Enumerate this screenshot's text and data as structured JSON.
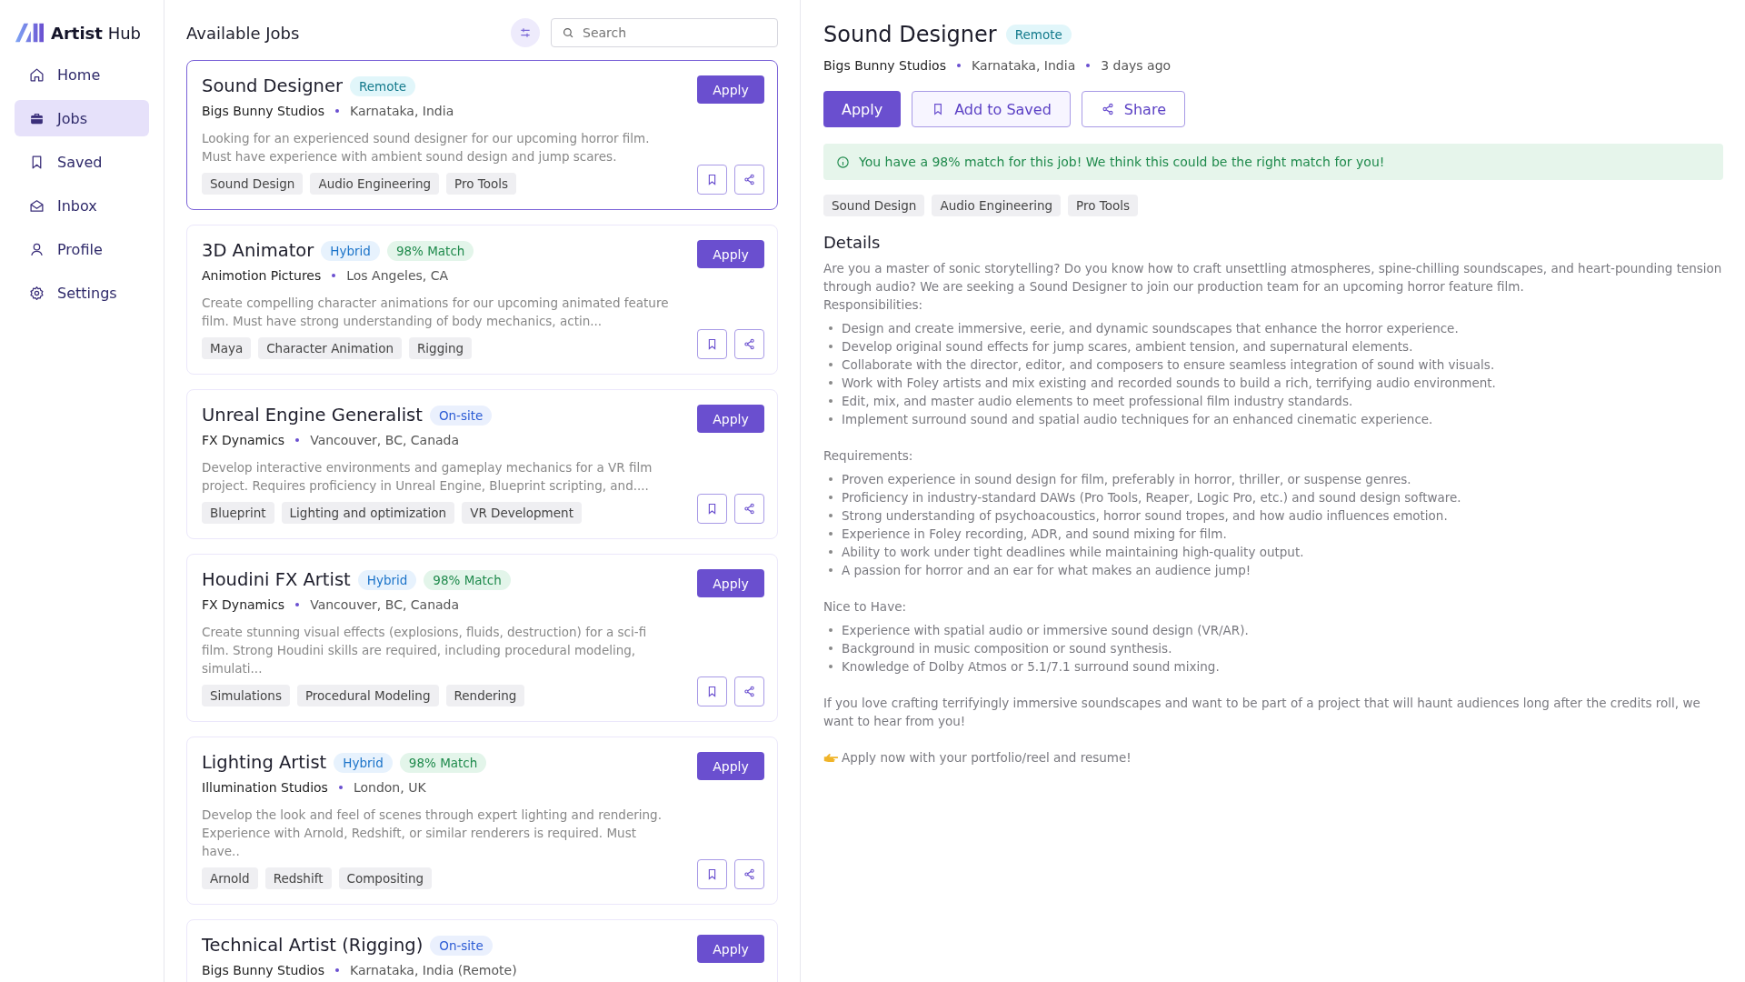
{
  "sidebar": {
    "brand": "**Artist** Hub",
    "items": [
      {
        "label": "Home",
        "selected": false
      },
      {
        "label": "Jobs",
        "selected": true
      },
      {
        "label": "Saved",
        "selected": false
      },
      {
        "label": "Inbox",
        "selected": false
      },
      {
        "label": "Profile",
        "selected": false
      },
      {
        "label": "Settings",
        "selected": false
      }
    ]
  },
  "job_list": {
    "title": "Available Jobs",
    "search": {
      "placeholder": "Search"
    },
    "jobs": [
      {
        "title": "Sound Designer",
        "selected": true,
        "badges": [
          {
            "kind": "remote",
            "text": "Remote"
          }
        ],
        "company": "Bigs Bunny Studios",
        "location": "Karnataka, India",
        "description": "Looking for an experienced sound designer for our upcoming horror film. Must have experience with ambient sound design and jump scares.",
        "skills": [
          "Sound Design",
          "Audio Engineering",
          "Pro Tools"
        ],
        "apply": "Apply"
      },
      {
        "title": "3D Animator",
        "selected": false,
        "badges": [
          {
            "kind": "hybrid",
            "text": "Hybrid"
          },
          {
            "kind": "match",
            "text": "98% Match"
          }
        ],
        "company": "Animotion Pictures",
        "location": "Los Angeles, CA",
        "description": "Create compelling character animations for our upcoming animated feature film. Must have strong understanding of body mechanics, actin...",
        "skills": [
          "Maya",
          "Character Animation",
          "Rigging"
        ],
        "apply": "Apply"
      },
      {
        "title": "Unreal Engine Generalist",
        "selected": false,
        "badges": [
          {
            "kind": "onsite",
            "text": "On-site"
          }
        ],
        "company": "FX Dynamics",
        "location": "Vancouver, BC, Canada",
        "description": "Develop interactive environments and gameplay mechanics for a VR film project. Requires proficiency in Unreal Engine, Blueprint scripting, and....",
        "skills": [
          "Blueprint",
          "Lighting and optimization",
          "VR Development"
        ],
        "apply": "Apply"
      },
      {
        "title": "Houdini FX Artist",
        "selected": false,
        "badges": [
          {
            "kind": "hybrid",
            "text": "Hybrid"
          },
          {
            "kind": "match",
            "text": "98% Match"
          }
        ],
        "company": "FX Dynamics",
        "location": "Vancouver, BC, Canada",
        "description": "Create stunning visual effects (explosions, fluids, destruction) for a sci-fi film. Strong Houdini skills are required, including procedural modeling, simulati...",
        "skills": [
          "Simulations",
          "Procedural Modeling",
          "Rendering"
        ],
        "apply": "Apply"
      },
      {
        "title": "Lighting Artist",
        "selected": false,
        "badges": [
          {
            "kind": "hybrid",
            "text": "Hybrid"
          },
          {
            "kind": "match",
            "text": "98% Match"
          }
        ],
        "company": "Illumination Studios",
        "location": "London, UK",
        "description": "Develop the look and feel of scenes through expert lighting and rendering. Experience with Arnold, Redshift, or similar renderers is required. Must have..",
        "skills": [
          "Arnold",
          "Redshift",
          "Compositing"
        ],
        "apply": "Apply"
      },
      {
        "title": "Technical Artist (Rigging)",
        "selected": false,
        "badges": [
          {
            "kind": "onsite",
            "text": "On-site"
          }
        ],
        "company": "Bigs Bunny Studios",
        "location": "Karnataka, India (Remote)",
        "apply": "Apply"
      }
    ]
  },
  "detail": {
    "title": "Sound Designer",
    "badge": {
      "kind": "remote",
      "text": "Remote"
    },
    "company": "Bigs Bunny Studios",
    "location": "Karnataka, India",
    "posted": "3 days ago",
    "buttons": [
      {
        "kind": "primary",
        "label": "Apply"
      },
      {
        "kind": "save",
        "label": "Add to Saved"
      },
      {
        "kind": "share",
        "label": "Share"
      }
    ],
    "match_banner": "You have a 98% match for this job! We think this could be the right match for you!",
    "skills": [
      "Sound Design",
      "Audio Engineering",
      "Pro Tools"
    ],
    "details_heading": "Details",
    "blocks": [
      {
        "kind": "para",
        "text": "Are you a master of sonic storytelling? Do you know how to craft unsettling atmospheres, spine-chilling soundscapes, and heart-pounding tension through audio? We are seeking a Sound Designer to join our production team for an upcoming horror feature film."
      },
      {
        "kind": "label",
        "text": "Responsibilities:"
      },
      {
        "kind": "list",
        "items": [
          "Design and create immersive, eerie, and dynamic soundscapes that enhance the horror experience.",
          "Develop original sound effects for jump scares, ambient tension, and supernatural elements.",
          "Collaborate with the director, editor, and composers to ensure seamless integration of sound with visuals.",
          "Work with Foley artists and mix existing and recorded sounds to build a rich, terrifying audio environment.",
          "Edit, mix, and master audio elements to meet professional film industry standards.",
          "Implement surround sound and spatial audio techniques for an enhanced cinematic experience."
        ]
      },
      {
        "kind": "label",
        "text": "Requirements:"
      },
      {
        "kind": "list",
        "items": [
          "Proven experience in sound design for film, preferably in horror, thriller, or suspense genres.",
          "Proficiency in industry-standard DAWs (Pro Tools, Reaper, Logic Pro, etc.) and sound design software.",
          "Strong understanding of psychoacoustics, horror sound tropes, and how audio influences emotion.",
          "Experience in Foley recording, ADR, and sound mixing for film.",
          "Ability to work under tight deadlines while maintaining high-quality output.",
          "A passion for horror and an ear for what makes an audience jump!"
        ]
      },
      {
        "kind": "label",
        "text": "Nice to Have:"
      },
      {
        "kind": "list",
        "items": [
          "Experience with spatial audio or immersive sound design (VR/AR).",
          "Background in music composition or sound synthesis.",
          "Knowledge of Dolby Atmos or 5.1/7.1 surround sound mixing."
        ]
      },
      {
        "kind": "para",
        "text": "If you love crafting terrifyingly immersive soundscapes and want to be part of a project that will haunt audiences long after the credits roll, we want to hear from you!"
      },
      {
        "kind": "cta",
        "text": "Apply now with your portfolio/reel and resume!"
      }
    ]
  }
}
